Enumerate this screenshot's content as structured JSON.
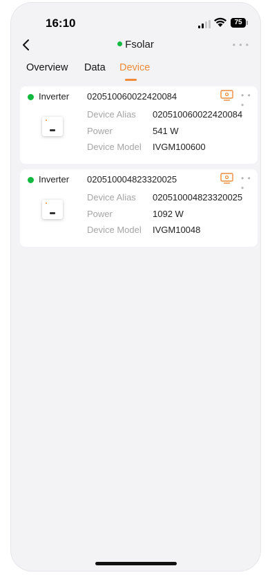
{
  "status_bar": {
    "time": "16:10",
    "battery": "75"
  },
  "header": {
    "title": "Fsolar",
    "status_color": "#13b83f",
    "back_icon": "chevron-left-icon",
    "more_icon": "ellipsis-icon"
  },
  "tabs": [
    {
      "label": "Overview",
      "active": false
    },
    {
      "label": "Data",
      "active": false
    },
    {
      "label": "Device",
      "active": true
    }
  ],
  "accent_color": "#f08a38",
  "devices": [
    {
      "type": "Inverter",
      "serial": "020510060022420084",
      "online": true,
      "fields": [
        {
          "label": "Device Alias",
          "value": "020510060022420084"
        },
        {
          "label": "Power",
          "value": "541 W"
        },
        {
          "label": "Device Model",
          "value": "IVGM100600"
        }
      ]
    },
    {
      "type": "Inverter",
      "serial": "020510004823320025",
      "online": true,
      "fields": [
        {
          "label": "Device Alias",
          "value": "020510004823320025"
        },
        {
          "label": "Power",
          "value": "1092 W"
        },
        {
          "label": "Device Model",
          "value": "IVGM10048"
        }
      ]
    }
  ]
}
